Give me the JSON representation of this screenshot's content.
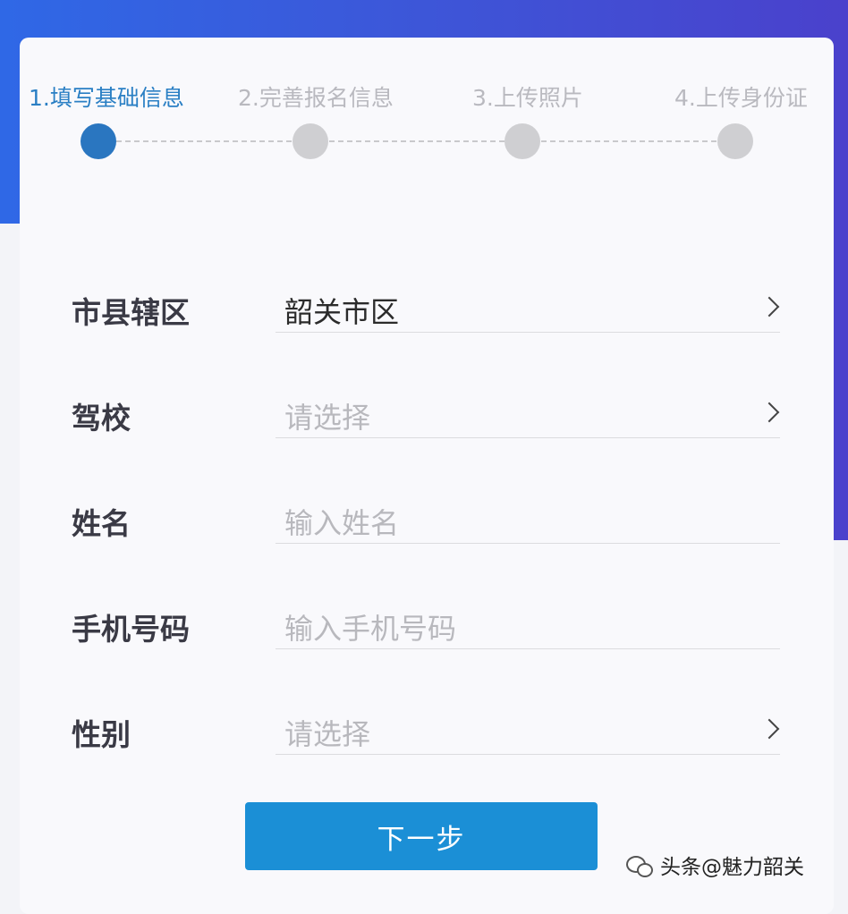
{
  "steps": [
    {
      "label": "1.填写基础信息",
      "active": true
    },
    {
      "label": "2.完善报名信息",
      "active": false
    },
    {
      "label": "3.上传照片",
      "active": false
    },
    {
      "label": "4.上传身份证",
      "active": false
    }
  ],
  "form": {
    "district": {
      "label": "市县辖区",
      "value": "韶关市区"
    },
    "school": {
      "label": "驾校",
      "placeholder": "请选择"
    },
    "name": {
      "label": "姓名",
      "placeholder": "输入姓名"
    },
    "phone": {
      "label": "手机号码",
      "placeholder": "输入手机号码"
    },
    "gender": {
      "label": "性别",
      "placeholder": "请选择"
    }
  },
  "next_button": "下一步",
  "watermark": "头条@魅力韶关",
  "colors": {
    "accent": "#1b8fd6",
    "active_step": "#2a76c0",
    "header_gradient_start": "#2f68e6",
    "header_gradient_end": "#4a41cc"
  }
}
